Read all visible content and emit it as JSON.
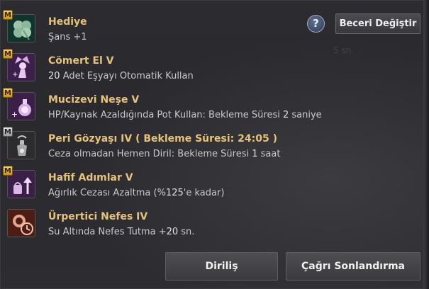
{
  "header": {
    "help_glyph": "?",
    "change_skill_button": "Beceri Değiştir",
    "ghost_text": "5 sn."
  },
  "skills": [
    {
      "badge": "M",
      "badge_color": "gold",
      "name": "Hediye",
      "desc": "Şans +1",
      "icon": "clover-icon"
    },
    {
      "badge": "M",
      "badge_color": "gold",
      "name": "Cömert El V",
      "desc_num": "20",
      "desc": "Adet Eşyayı Otomatik Kullan",
      "icon": "fairy-icon"
    },
    {
      "badge": "M",
      "badge_color": "gold",
      "name": "Mucizevi Neşe V",
      "desc": "HP/Kaynak Azaldığında Pot Kullan: Bekleme Süresi",
      "desc_num": "2",
      "desc_tail": "saniye",
      "icon": "potion-icon"
    },
    {
      "badge": "M",
      "badge_color": "silver",
      "name": "Peri Gözyaşı IV  ( Bekleme Süresi: 24:05 )",
      "desc": "Ceza olmadan Hemen Diril: Bekleme Süresi",
      "desc_num": "1",
      "desc_tail": "saat",
      "icon": "tear-bottle-icon"
    },
    {
      "badge": "M",
      "badge_color": "gold",
      "name": "Hafif Adımlar V",
      "desc": "Ağırlık Cezası Azaltma (%",
      "desc_num": "125",
      "desc_tail": "'e kadar)",
      "icon": "weight-up-icon"
    },
    {
      "badge": "",
      "badge_color": "",
      "name": "Ürpertici Nefes IV",
      "desc": "Su Altında Nefes Tutma +",
      "desc_num": "20",
      "desc_tail": "sn.",
      "icon": "breath-timer-icon"
    }
  ],
  "footer": {
    "revive_button": "Diriliş",
    "end_call_button": "Çağrı Sonlandırma"
  }
}
